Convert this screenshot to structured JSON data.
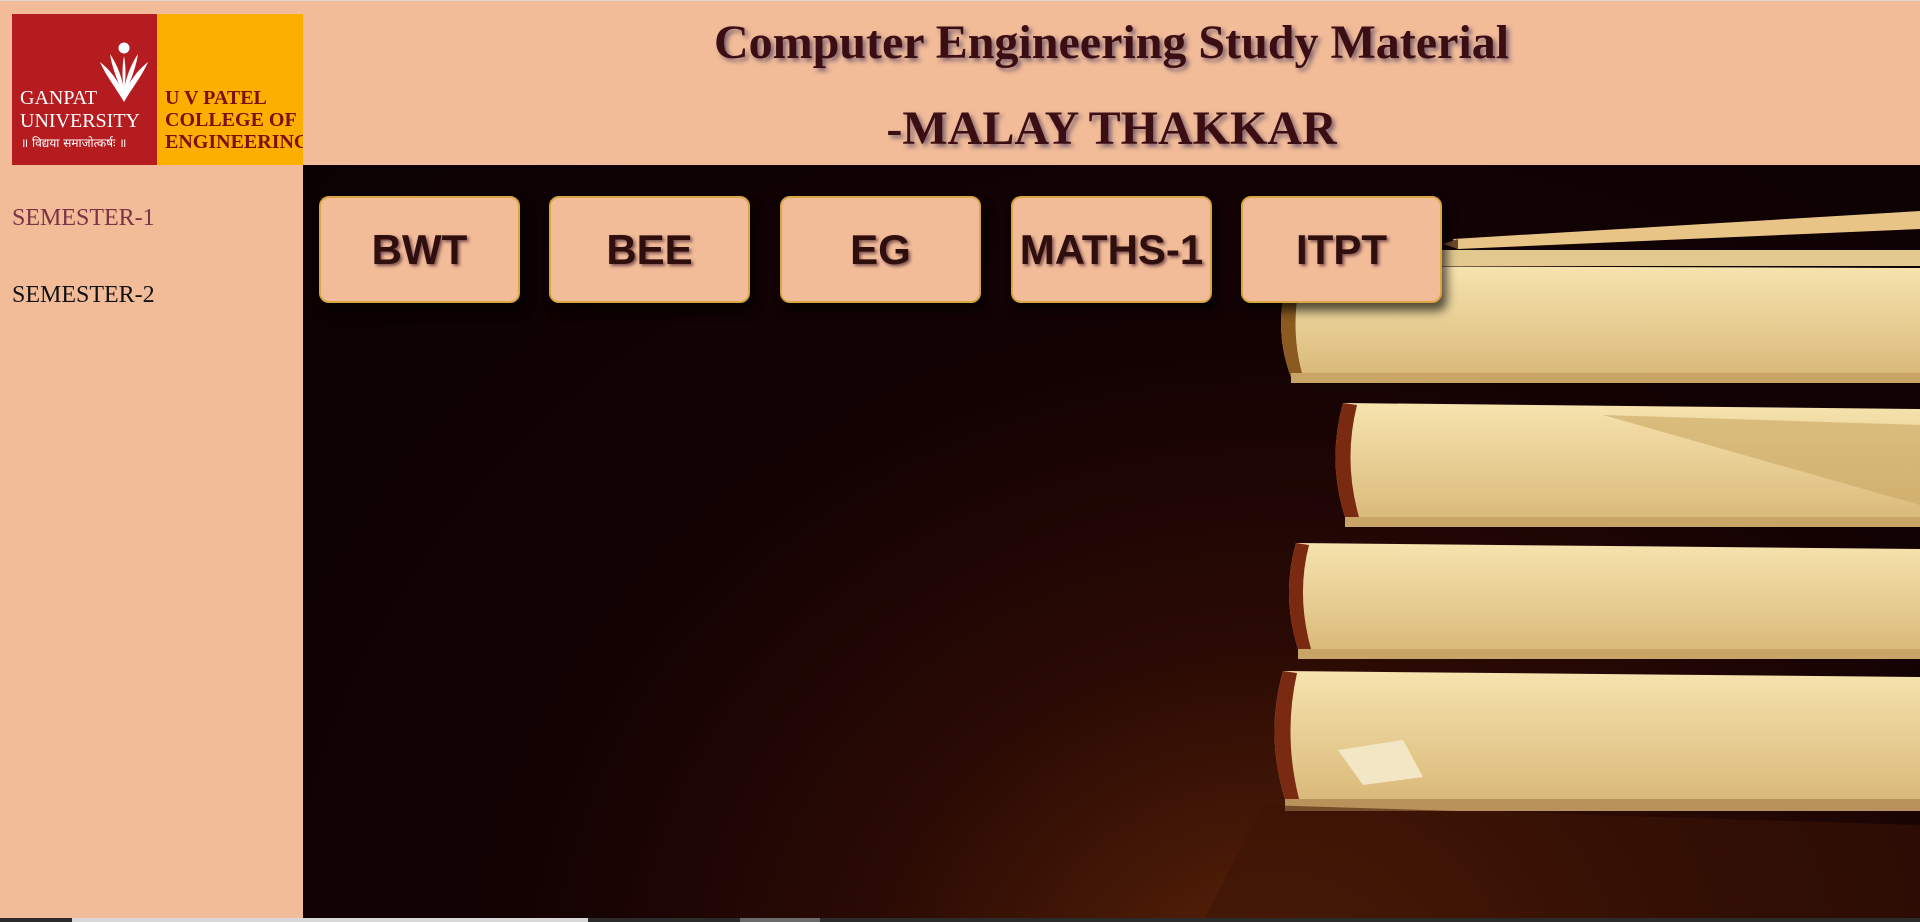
{
  "header": {
    "title_line1": "Computer Engineering Study Material",
    "title_line2": "-MALAY THAKKAR",
    "background": "#f2bc98",
    "title_color": "#3b0e14"
  },
  "logo": {
    "university_line1": "GANPAT",
    "university_line2": "UNIVERSITY",
    "motto": "॥ विद्यया समाजोत्कर्षः ॥",
    "college_line1": "U V PATEL",
    "college_line2": "COLLEGE OF",
    "college_line3": "ENGINEERING",
    "colors": {
      "red": "#b51c20",
      "yellow": "#fbb000"
    }
  },
  "sidebar": {
    "items": [
      {
        "label": "SEMESTER-1",
        "color": "#7b3245"
      },
      {
        "label": "SEMESTER-2",
        "color": "#111111"
      }
    ]
  },
  "subjects": [
    {
      "label": "BWT"
    },
    {
      "label": "BEE"
    },
    {
      "label": "EG"
    },
    {
      "label": "MATHS-1"
    },
    {
      "label": "ITPT"
    }
  ],
  "background_image": "stacked-books-with-pencil"
}
